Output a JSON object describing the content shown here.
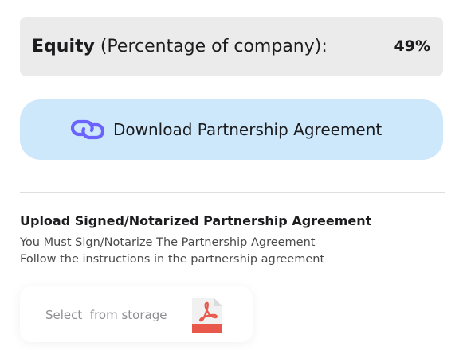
{
  "equity": {
    "label_bold": "Equity",
    "label_rest": " (Percentage of company):",
    "value": "49%"
  },
  "download": {
    "label": "Download Partnership Agreement",
    "icon": "link-icon",
    "accent_color": "#6c63ff"
  },
  "upload": {
    "title": "Upload Signed/Notarized Partnership Agreement",
    "line1": "You Must Sign/Notarize The Partnership Agreement",
    "line2": "Follow the instructions in the partnership agreement"
  },
  "storage": {
    "label": "Select  from storage",
    "icon": "pdf-file-icon",
    "icon_color": "#e8584b"
  },
  "colors": {
    "equity_card_bg": "#ebebeb",
    "download_bg": "#cde8fa"
  }
}
